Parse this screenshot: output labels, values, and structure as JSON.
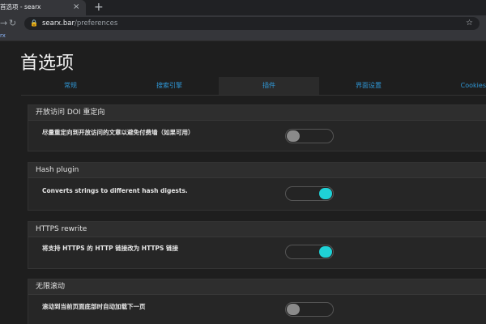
{
  "browser": {
    "tab_title": "首选项 - searx",
    "tab_close": "×",
    "new_tab": "+",
    "back": "→",
    "reload": "↻",
    "url_host": "searx.bar",
    "url_path": "/preferences",
    "bookmark": "rx"
  },
  "page": {
    "title": "首选项",
    "tabs": [
      {
        "label": "常规"
      },
      {
        "label": "搜索引擎"
      },
      {
        "label": "插件"
      },
      {
        "label": "界面设置"
      },
      {
        "label": "Cookies"
      }
    ],
    "active_tab": 2
  },
  "plugins": [
    {
      "title": "开放访问 DOI 重定向",
      "description": "尽量重定向到开放访问的文章以避免付费墙（如果可用）",
      "enabled": false
    },
    {
      "title": "Hash plugin",
      "description": "Converts strings to different hash digests.",
      "enabled": true
    },
    {
      "title": "HTTPS rewrite",
      "description": "将支持 HTTPS 的 HTTP 链接改为 HTTPS 链接",
      "enabled": true
    },
    {
      "title": "无限滚动",
      "description": "滚动到当前页面底部时自动加载下一页",
      "enabled": false
    }
  ],
  "colors": {
    "accent": "#2f97d6",
    "toggle_on": "#1fd1d6",
    "toggle_off": "#8a8a8a",
    "background": "#1e1e1e"
  },
  "icons": {
    "lock": "lock-icon",
    "star": "star-icon"
  }
}
